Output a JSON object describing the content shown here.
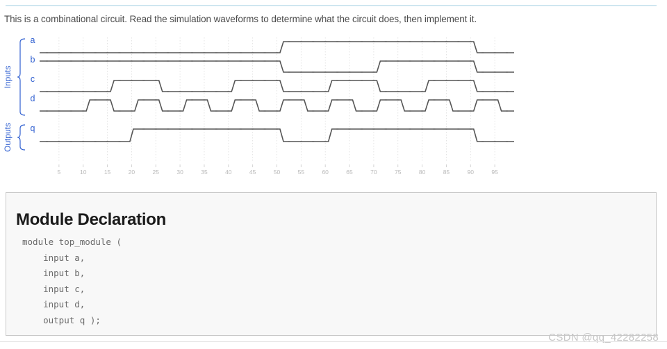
{
  "description": "This is a combinational circuit. Read the simulation waveforms to determine what the circuit does, then implement it.",
  "watermark": "CSDN @qq_42282258",
  "colors": {
    "signal_label": "#2f5fd0",
    "waveform": "#555555",
    "gridline": "#dddddd",
    "tick_label": "#b9b9b9",
    "panel_background": "#f8f8f8",
    "panel_border": "#c9c9c9",
    "top_rule": "#cfe6f0"
  },
  "waveform": {
    "group_labels": {
      "inputs": "Inputs",
      "outputs": "Outputs"
    },
    "x_axis": {
      "ticks": [
        5,
        10,
        15,
        20,
        25,
        30,
        35,
        40,
        45,
        50,
        55,
        60,
        65,
        70,
        75,
        80,
        85,
        90,
        95
      ],
      "t_min": 1,
      "t_max": 99
    }
  },
  "chart_data": {
    "type": "line",
    "title": "",
    "xlabel": "",
    "ylabel": "",
    "xlim": [
      1,
      99
    ],
    "grid": true,
    "legend": "left-row-labels",
    "series": [
      {
        "name": "a",
        "group": "Inputs",
        "initial": 0,
        "transitions": [
          {
            "t": 51,
            "value": 1
          },
          {
            "t": 91,
            "value": 0
          }
        ]
      },
      {
        "name": "b",
        "group": "Inputs",
        "initial": 1,
        "transitions": [
          {
            "t": 51,
            "value": 0
          },
          {
            "t": 71,
            "value": 1
          },
          {
            "t": 91,
            "value": 0
          }
        ]
      },
      {
        "name": "c",
        "group": "Inputs",
        "initial": 0,
        "transitions": [
          {
            "t": 16,
            "value": 1
          },
          {
            "t": 26,
            "value": 0
          },
          {
            "t": 41,
            "value": 1
          },
          {
            "t": 51,
            "value": 0
          },
          {
            "t": 61,
            "value": 1
          },
          {
            "t": 71,
            "value": 0
          },
          {
            "t": 81,
            "value": 1
          },
          {
            "t": 91,
            "value": 0
          }
        ]
      },
      {
        "name": "d",
        "group": "Inputs",
        "initial": 0,
        "transitions": [
          {
            "t": 11,
            "value": 1
          },
          {
            "t": 16,
            "value": 0
          },
          {
            "t": 21,
            "value": 1
          },
          {
            "t": 26,
            "value": 0
          },
          {
            "t": 31,
            "value": 1
          },
          {
            "t": 36,
            "value": 0
          },
          {
            "t": 41,
            "value": 1
          },
          {
            "t": 46,
            "value": 0
          },
          {
            "t": 51,
            "value": 1
          },
          {
            "t": 56,
            "value": 0
          },
          {
            "t": 61,
            "value": 1
          },
          {
            "t": 66,
            "value": 0
          },
          {
            "t": 71,
            "value": 1
          },
          {
            "t": 76,
            "value": 0
          },
          {
            "t": 81,
            "value": 1
          },
          {
            "t": 86,
            "value": 0
          },
          {
            "t": 91,
            "value": 1
          },
          {
            "t": 96,
            "value": 0
          }
        ]
      },
      {
        "name": "q",
        "group": "Outputs",
        "initial": 0,
        "transitions": [
          {
            "t": 20,
            "value": 1
          },
          {
            "t": 51,
            "value": 0
          },
          {
            "t": 61,
            "value": 1
          },
          {
            "t": 91,
            "value": 0
          }
        ]
      }
    ]
  },
  "module_panel": {
    "title": "Module Declaration",
    "code": "module top_module (\n    input a,\n    input b,\n    input c,\n    input d,\n    output q );"
  }
}
